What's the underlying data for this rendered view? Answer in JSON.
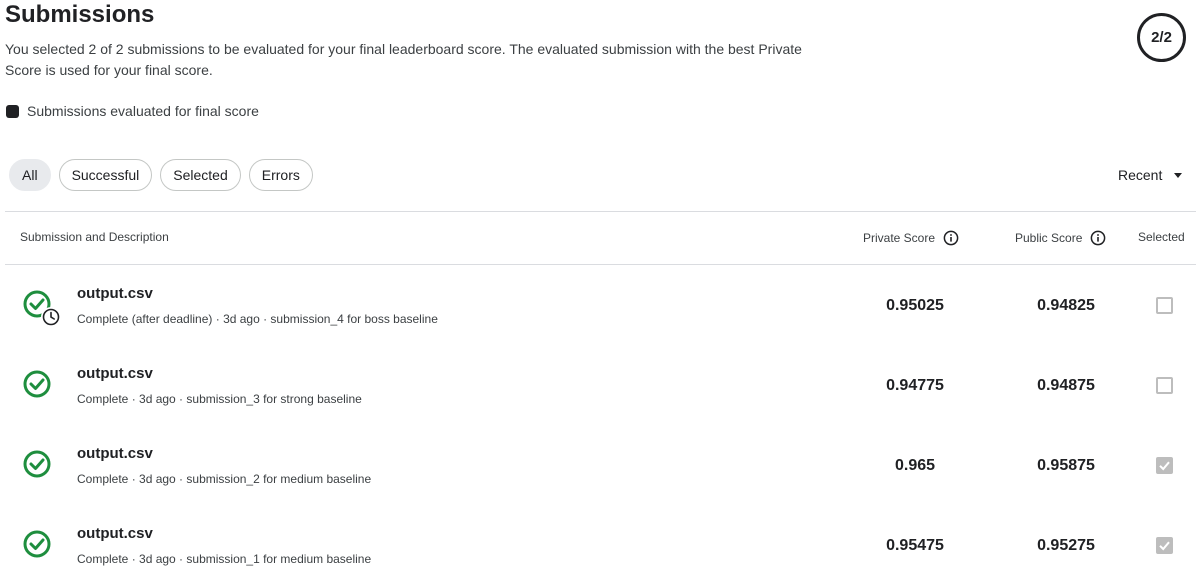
{
  "header": {
    "title": "Submissions",
    "subtitle": "You selected 2 of 2 submissions to be evaluated for your final leaderboard score. The evaluated submission with the best Private Score is used for your final score.",
    "counter": "2/2",
    "legend_label": "Submissions evaluated for final score"
  },
  "filters": [
    "All",
    "Successful",
    "Selected",
    "Errors"
  ],
  "active_filter": "All",
  "sort": {
    "label": "Recent"
  },
  "table": {
    "columns": {
      "submission": "Submission and Description",
      "private": "Private Score",
      "public": "Public Score",
      "selected": "Selected"
    },
    "rows": [
      {
        "file": "output.csv",
        "desc": "Complete (after deadline) · 3d ago · submission_4 for boss baseline",
        "private": "0.95025",
        "public": "0.94825",
        "selected": false,
        "late": true
      },
      {
        "file": "output.csv",
        "desc": "Complete · 3d ago · submission_3 for strong baseline",
        "private": "0.94775",
        "public": "0.94875",
        "selected": false,
        "late": false
      },
      {
        "file": "output.csv",
        "desc": "Complete · 3d ago · submission_2 for medium baseline",
        "private": "0.965",
        "public": "0.95875",
        "selected": true,
        "late": false
      },
      {
        "file": "output.csv",
        "desc": "Complete · 3d ago · submission_1 for medium baseline",
        "private": "0.95475",
        "public": "0.95275",
        "selected": true,
        "late": false
      }
    ]
  },
  "colors": {
    "success": "#1e8e3e",
    "text": "#202124",
    "muted": "#3c4043",
    "border": "#dadce0",
    "checkbox": "#bdbdbd"
  },
  "icons": {
    "status": "check-circle-icon",
    "late": "clock-icon",
    "info": "info-icon",
    "sort": "caret-down-icon"
  }
}
